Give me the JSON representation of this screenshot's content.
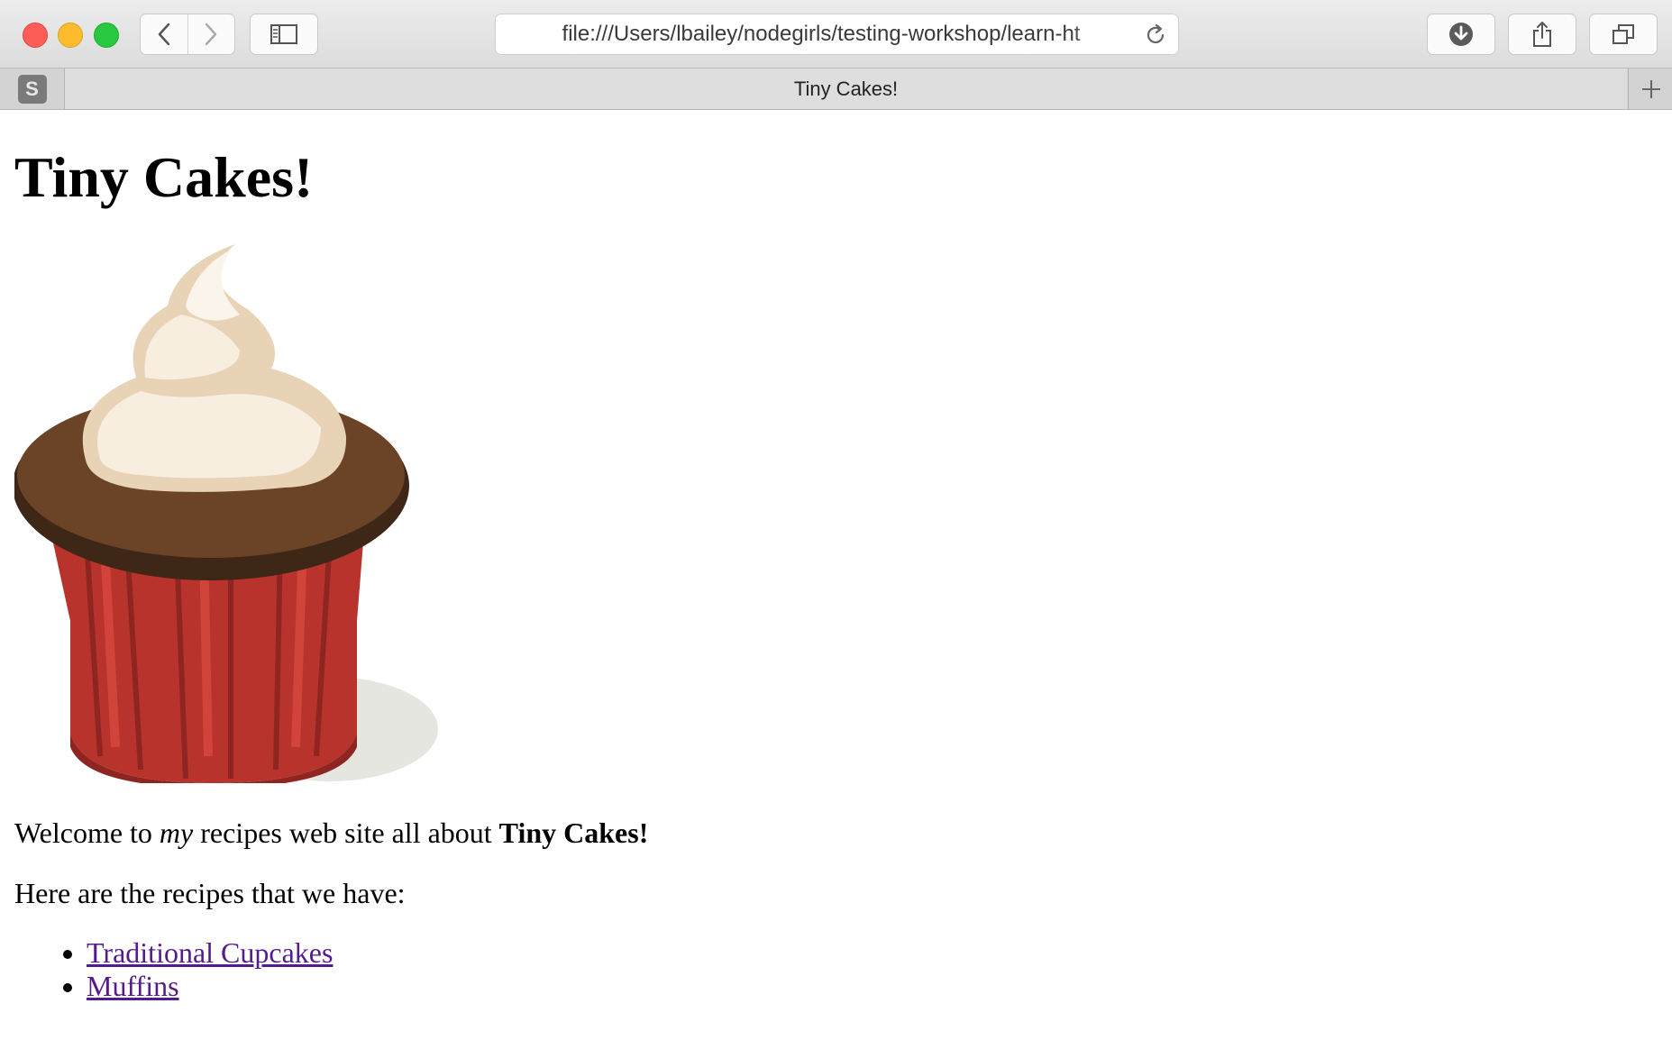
{
  "browser": {
    "url": "file:///Users/lbailey/nodegirls/testing-workshop/learn-ht",
    "pinned_tab_letter": "S",
    "active_tab_title": "Tiny Cakes!"
  },
  "page": {
    "heading": "Tiny Cakes!",
    "image_alt": "cupcake",
    "intro": {
      "before": "Welcome to ",
      "emphasis": "my",
      "middle": " recipes web site all about ",
      "strong": "Tiny Cakes!"
    },
    "recipes_intro": "Here are the recipes that we have:",
    "recipes": [
      {
        "label": "Traditional Cupcakes"
      },
      {
        "label": "Muffins"
      }
    ]
  },
  "colors": {
    "link_visited": "#551a8b",
    "close": "#fc5e57",
    "minimize": "#fdbc2e",
    "maximize": "#28c940"
  },
  "icons": [
    "back-icon",
    "forward-icon",
    "sidebar-icon",
    "reload-icon",
    "download-icon",
    "share-icon",
    "tabs-overview-icon",
    "plus-icon"
  ]
}
